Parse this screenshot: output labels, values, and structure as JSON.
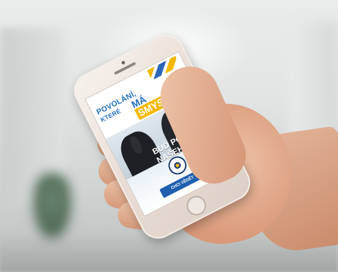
{
  "screen": {
    "heading_line1": "POVOLÁNÍ,",
    "heading_line2": "KTERÉ",
    "heading_ma": "MÁ",
    "heading_smysl": "SMYSL",
    "slogan_line1": "BUĎ POSILOU",
    "slogan_line2": "NAŠEHO TÝMU",
    "cta_label": "CHCI VĚDĚT VÍC"
  },
  "colors": {
    "accent_blue": "#1f6fc0",
    "accent_yellow": "#f5b800",
    "button_blue": "#1f5fae"
  }
}
